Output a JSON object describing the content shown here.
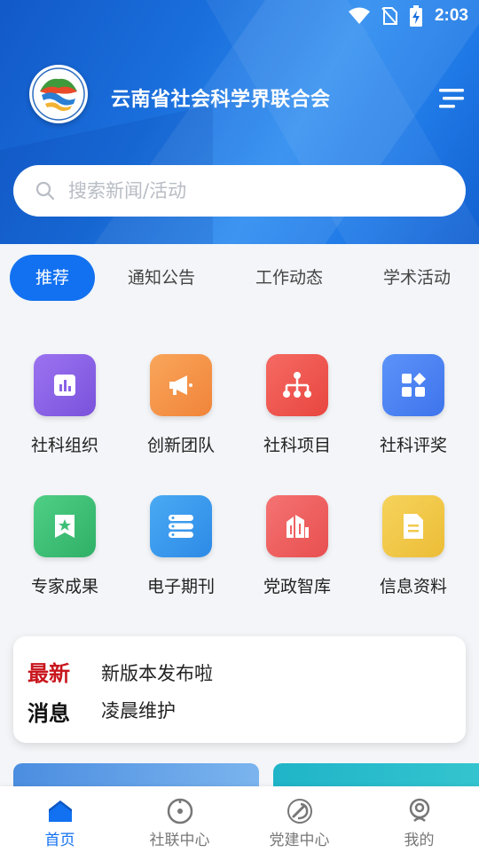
{
  "status_bar": {
    "time": "2:03"
  },
  "header": {
    "title": "云南省社会科学界联合会"
  },
  "search": {
    "placeholder": "搜索新闻/活动"
  },
  "tabs": [
    {
      "label": "推荐",
      "active": true
    },
    {
      "label": "通知公告",
      "active": false
    },
    {
      "label": "工作动态",
      "active": false
    },
    {
      "label": "学术活动",
      "active": false
    }
  ],
  "grid": [
    {
      "label": "社科组织",
      "icon": "chart-icon",
      "color": "#8a63e6"
    },
    {
      "label": "创新团队",
      "icon": "megaphone-icon",
      "color": "#f5994a"
    },
    {
      "label": "社科项目",
      "icon": "org-chart-icon",
      "color": "#ef5350"
    },
    {
      "label": "社科评奖",
      "icon": "apps-icon",
      "color": "#4f86f7"
    },
    {
      "label": "专家成果",
      "icon": "bookmark-star-icon",
      "color": "#3fbf77"
    },
    {
      "label": "电子期刊",
      "icon": "layers-icon",
      "color": "#3d9ef0"
    },
    {
      "label": "党政智库",
      "icon": "buildings-icon",
      "color": "#f06262"
    },
    {
      "label": "信息资料",
      "icon": "document-icon",
      "color": "#f2c94c"
    }
  ],
  "news": {
    "tag_line1": "最新",
    "tag_line2": "消息",
    "items": [
      "新版本发布啦",
      "凌晨维护"
    ]
  },
  "bottom_nav": [
    {
      "label": "首页",
      "icon": "home-icon",
      "active": true
    },
    {
      "label": "社联中心",
      "icon": "compass-icon",
      "active": false
    },
    {
      "label": "党建中心",
      "icon": "party-emblem-icon",
      "active": false
    },
    {
      "label": "我的",
      "icon": "profile-icon",
      "active": false
    }
  ],
  "colors": {
    "primary": "#1271f0",
    "news_accent": "#c8161d"
  }
}
